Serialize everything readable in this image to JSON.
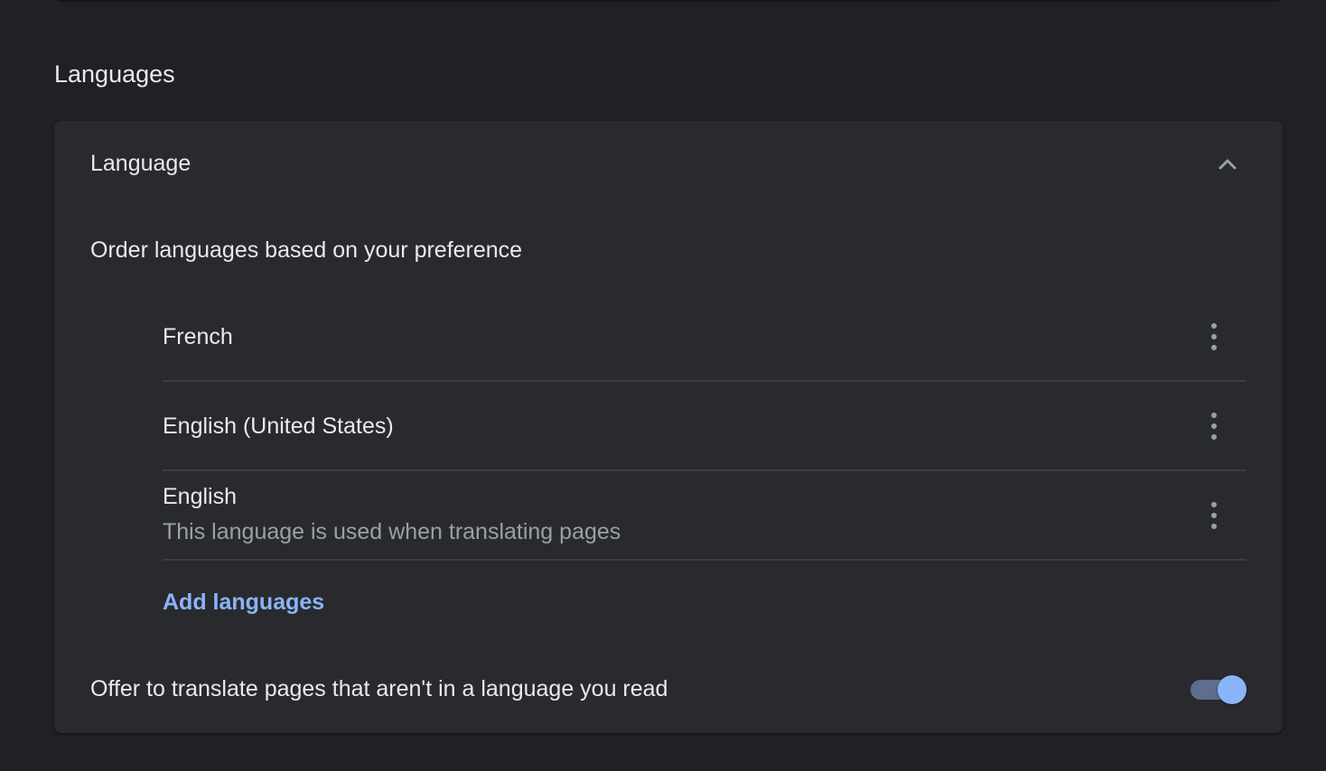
{
  "section": {
    "title": "Languages"
  },
  "language_card": {
    "header_label": "Language",
    "expanded": true,
    "collapse_icon": "chevron-up-icon",
    "order_label": "Order languages based on your preference",
    "languages": [
      {
        "name": "French",
        "note": "",
        "menu_icon": "more-vert-icon"
      },
      {
        "name": "English (United States)",
        "note": "",
        "menu_icon": "more-vert-icon"
      },
      {
        "name": "English",
        "note": "This language is used when translating pages",
        "menu_icon": "more-vert-icon"
      }
    ],
    "add_languages_label": "Add languages",
    "offer_translate_label": "Offer to translate pages that aren't in a language you read",
    "offer_translate_enabled": true
  },
  "colors": {
    "background": "#202124",
    "card": "#292a2d",
    "text_primary": "#e8eaed",
    "text_secondary": "#9aa0a6",
    "accent": "#8ab4f8",
    "toggle_track_on": "#5e6d90",
    "divider": "#3c3d40"
  }
}
